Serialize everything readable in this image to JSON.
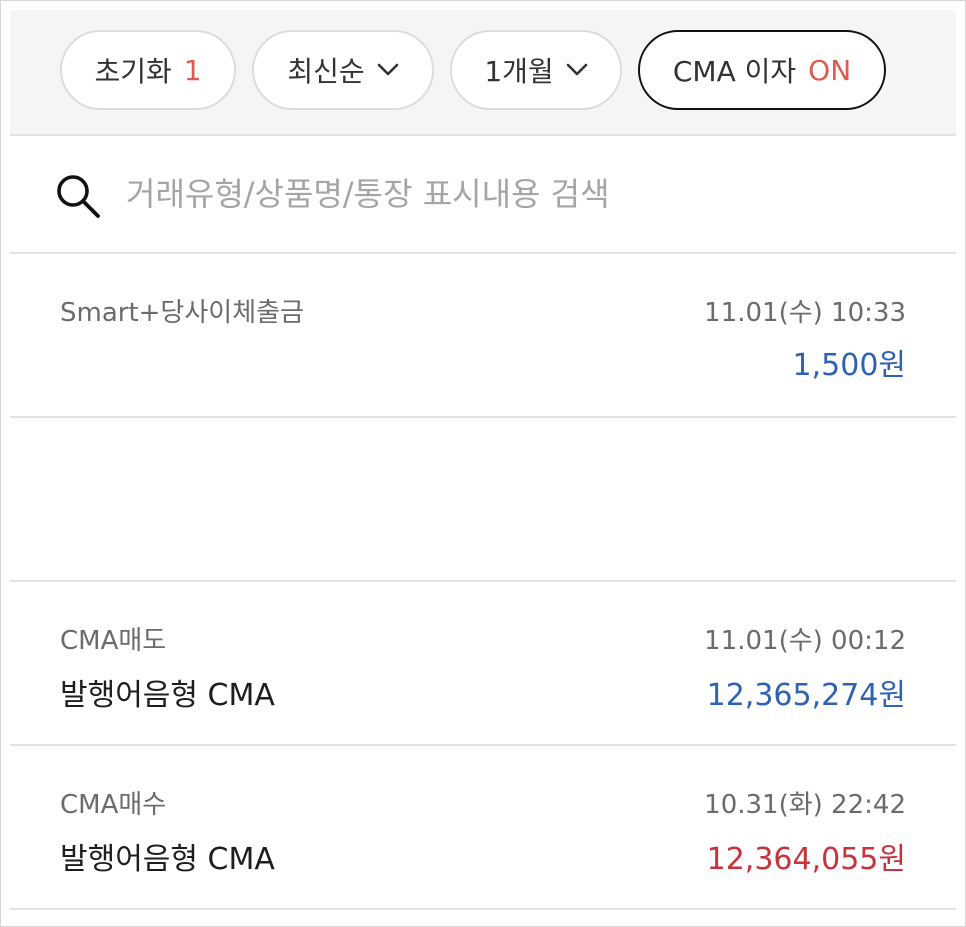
{
  "filters": {
    "reset_label": "초기화",
    "reset_count": "1",
    "sort_label": "최신순",
    "period_label": "1개월",
    "cma_interest_label": "CMA 이자",
    "cma_interest_state": "ON"
  },
  "search": {
    "placeholder": "거래유형/상품명/통장 표시내용 검색",
    "value": ""
  },
  "transactions": [
    {
      "type": "Smart+당사이체출금",
      "product": "",
      "datetime": "11.01(수) 10:33",
      "amount": "1,500원",
      "amount_color": "#2f62b3"
    },
    {
      "type": "CMA매도",
      "product": "발행어음형 CMA",
      "datetime": "11.01(수) 00:12",
      "amount": "12,365,274원",
      "amount_color": "#2f62b3"
    },
    {
      "type": "CMA매수",
      "product": "발행어음형 CMA",
      "datetime": "10.31(화) 22:42",
      "amount": "12,364,055원",
      "amount_color": "#c8323d"
    }
  ],
  "colors": {
    "accent_red": "#e05a4f",
    "withdraw_blue": "#2f62b3",
    "buy_red": "#c8323d"
  },
  "icons": {
    "search": "search-icon",
    "dropdown": "chevron-down-icon"
  }
}
